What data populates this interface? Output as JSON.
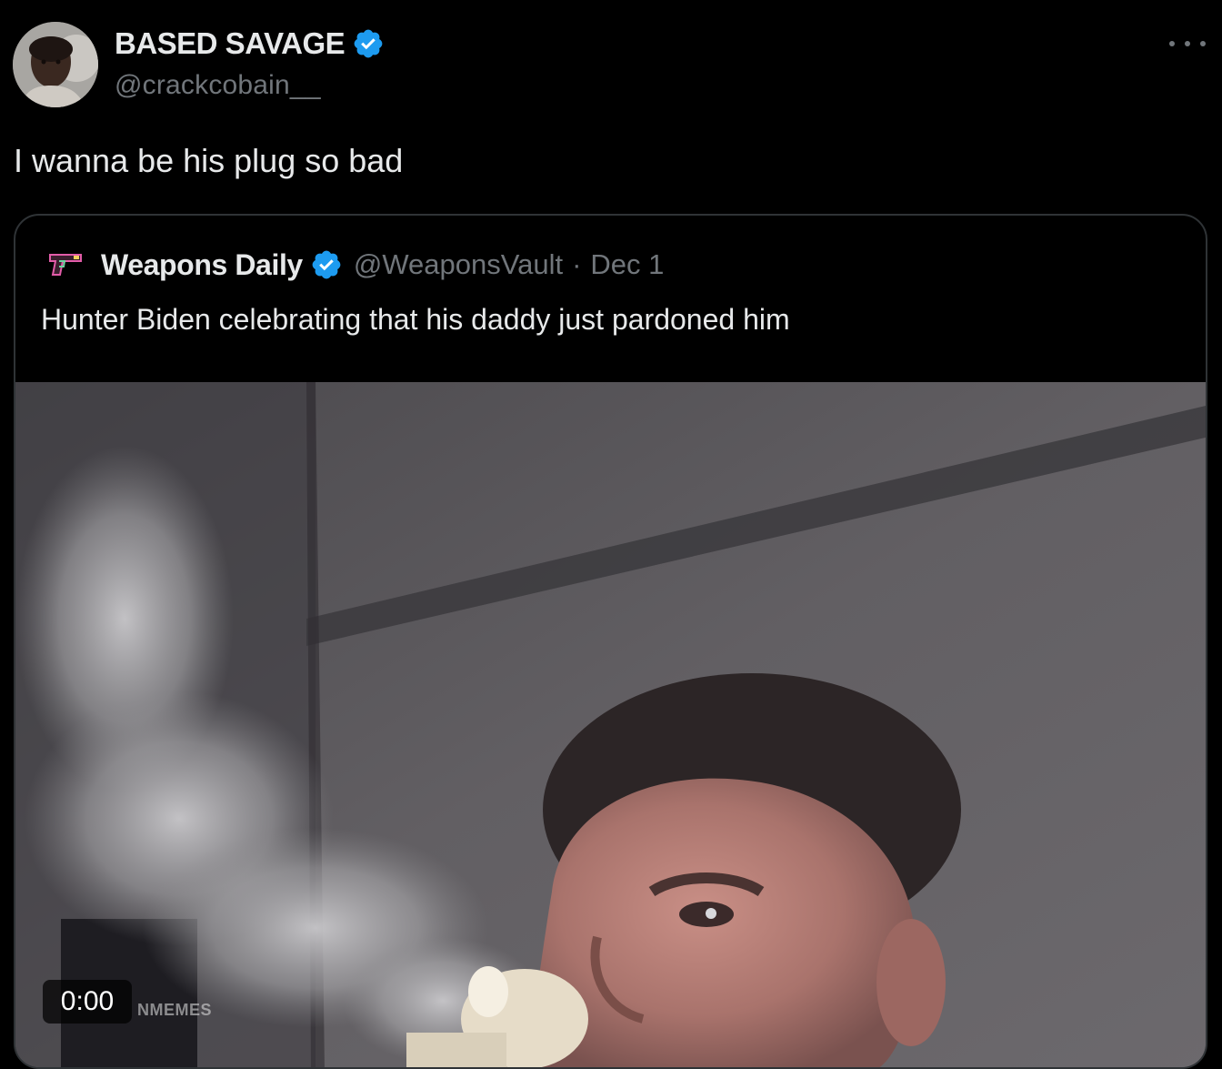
{
  "tweet": {
    "author": {
      "display_name": "BASED SAVAGE",
      "handle": "@crackcobain__",
      "verified": true,
      "avatar": "user-avatar"
    },
    "more_icon": "more-horizontal-icon",
    "text": "I wanna be his plug so bad"
  },
  "quoted_tweet": {
    "author": {
      "display_name": "Weapons Daily",
      "handle": "@WeaponsVault",
      "verified": true,
      "avatar": "pistol-avatar"
    },
    "separator": "·",
    "date": "Dec 1",
    "text": "Hunter Biden celebrating that his daddy just pardoned him",
    "media": {
      "type": "video",
      "time": "0:00",
      "watermark": "NMEMES"
    }
  },
  "colors": {
    "background": "#000000",
    "primary_text": "#e7e9ea",
    "secondary_text": "#71767b",
    "border": "#2f3336",
    "verified_blue": "#1d9bf0"
  }
}
